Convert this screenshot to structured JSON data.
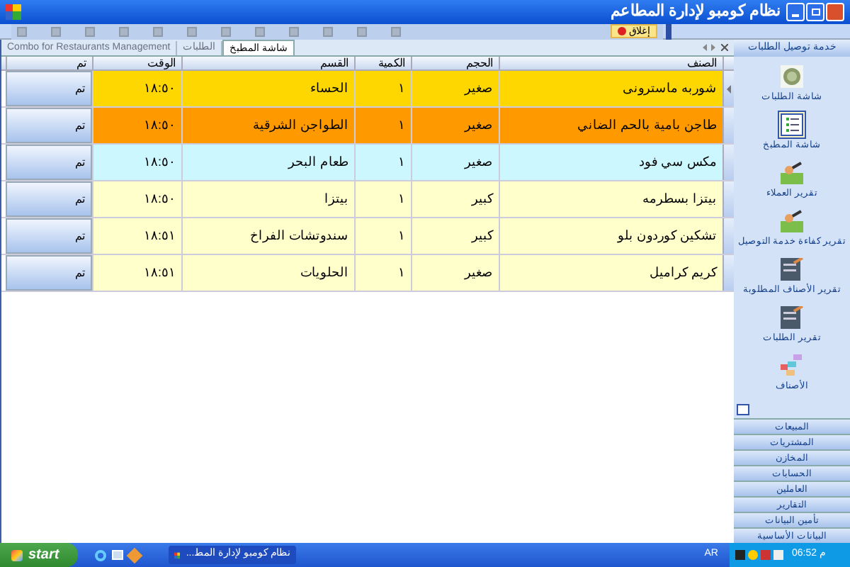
{
  "window": {
    "title": "نظام كومبو لإدارة المطاعم"
  },
  "toolbar": {
    "close_label": "إغلاق"
  },
  "tabs": [
    {
      "label": "شاشة المطبخ",
      "selected": true
    },
    {
      "label": "الطلبات",
      "selected": false
    },
    {
      "label": "Combo for Restaurants Management",
      "selected": false
    }
  ],
  "grid": {
    "columns": [
      "الصنف",
      "الحجم",
      "الكمية",
      "القسم",
      "الوقت",
      "تم"
    ],
    "rows": [
      {
        "current": true,
        "color": "#ffd700",
        "cells": [
          "شوربه ماسترونى",
          "صغير",
          "١",
          "الحساء",
          "١٨:٥٠"
        ],
        "button": "تم"
      },
      {
        "current": false,
        "color": "#ff9900",
        "cells": [
          "طاجن بامية بالحم الضاني",
          "صغير",
          "١",
          "الطواجن الشرقية",
          "١٨:٥٠"
        ],
        "button": "تم"
      },
      {
        "current": false,
        "color": "#ccf7ff",
        "cells": [
          "مكس سي فود",
          "صغير",
          "١",
          "طعام البحر",
          "١٨:٥٠"
        ],
        "button": "تم"
      },
      {
        "current": false,
        "color": "#ffffcc",
        "cells": [
          "بيتزا بسطرمه",
          "كبير",
          "١",
          "بيتزا",
          "١٨:٥٠"
        ],
        "button": "تم"
      },
      {
        "current": false,
        "color": "#ffffcc",
        "cells": [
          "تشكين كوردون بلو",
          "كبير",
          "١",
          "سندوتشات الفراخ",
          "١٨:٥١"
        ],
        "button": "تم"
      },
      {
        "current": false,
        "color": "#ffffcc",
        "cells": [
          "كريم كراميل",
          "صغير",
          "١",
          "الحلويات",
          "١٨:٥١"
        ],
        "button": "تم"
      }
    ]
  },
  "sidebar": {
    "title": "خدمة توصيل الطلبات",
    "items": [
      {
        "label": "شاشة الطلبات",
        "kind": "plate",
        "selected": false
      },
      {
        "label": "شاشة المطبخ",
        "kind": "list",
        "selected": true
      },
      {
        "label": "تقرير العملاء",
        "kind": "report",
        "selected": false
      },
      {
        "label": "تقرير كفاءة خدمة التوصيل",
        "kind": "report",
        "selected": false
      },
      {
        "label": "تقرير الأصناف المطلوبة",
        "kind": "doc",
        "selected": false
      },
      {
        "label": "تقرير الطلبات",
        "kind": "doc",
        "selected": false
      },
      {
        "label": "الأصناف",
        "kind": "blocks",
        "selected": false
      }
    ],
    "sections": [
      "المبيعات",
      "المشتريات",
      "المخازن",
      "الحسابات",
      "العاملين",
      "التقارير",
      "تأمين البيانات",
      "البيانات الأساسية"
    ]
  },
  "taskbar": {
    "start": "start",
    "task": "نظام كومبو لإدارة المط...",
    "language": "AR",
    "clock": "06:52 م"
  }
}
